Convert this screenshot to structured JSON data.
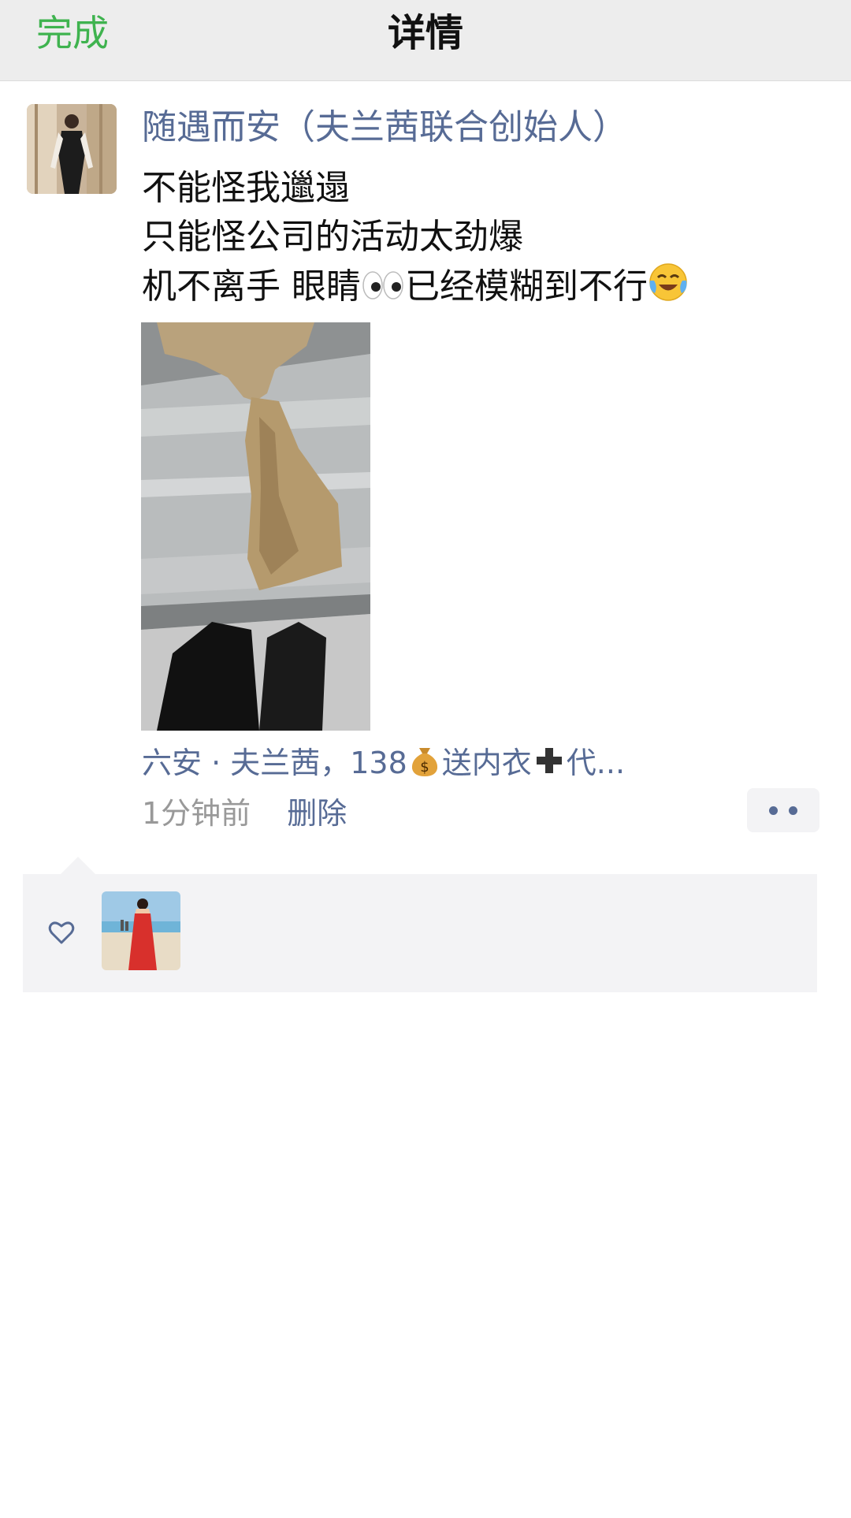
{
  "navbar": {
    "back_label": "完成",
    "title": "详情"
  },
  "post": {
    "author": "随遇而安（夫兰茜联合创始人）",
    "text_lines": [
      "不能怪我邋遢",
      "只能怪公司的活动太劲爆",
      "机不离手 眼睛"
    ],
    "text_line3_tail": "已经模糊到不行",
    "location_prefix": "六安 · 夫兰茜，138",
    "location_middle": "送内衣",
    "location_suffix": "代...",
    "time": "1分钟前",
    "delete_label": "删除",
    "icons": [
      "eyes-emoji-icon",
      "crying-laughing-emoji-icon",
      "money-bag-emoji-icon",
      "plus-icon",
      "more-dots-icon"
    ]
  },
  "likes": {
    "icon": "heart-outline-icon"
  },
  "colors": {
    "accent_green": "#3fb34f",
    "link_blue": "#576b95",
    "navbar_bg": "#ededed",
    "panel_bg": "#f3f3f5"
  }
}
